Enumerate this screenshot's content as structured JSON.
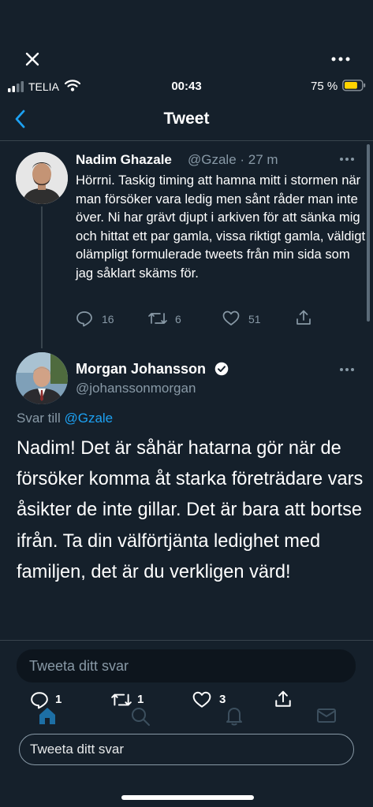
{
  "status_bar": {
    "carrier": "TELIA",
    "time": "00:43",
    "battery_percent": "75 %",
    "battery_level": 0.75,
    "colors": {
      "battery": "#ffd400"
    }
  },
  "nav": {
    "title": "Tweet",
    "back_icon": "chevron-left-icon"
  },
  "tweet1": {
    "name": "Nadim Ghazale",
    "handle_time": "@Gzale · 27 m",
    "text": "Hörrni. Taskig timing att hamna mitt i stormen när man försöker vara ledig men sånt råder man inte över. Ni har grävt djupt i arkiven för att sänka mig och hittat ett par gamla, vissa riktigt gamla, väldigt olämpligt formulerade tweets från min sida som jag såklart skäms för.",
    "replies": "16",
    "retweets": "6",
    "likes": "51"
  },
  "tweet2": {
    "name": "Morgan Johansson",
    "handle": "@johanssonmorgan",
    "reply_prefix": "Svar till ",
    "reply_handle": "@Gzale",
    "text": "Nadim! Det är såhär hatarna gör när de försöker komma åt starka företrädare vars åsikter de inte gillar. Det är bara att bortse ifrån. Ta din välförtjänta ledighet med familjen, det är du verkligen värd!"
  },
  "reply_box": {
    "placeholder": "Tweeta ditt svar"
  },
  "bottom_actions": {
    "replies": "1",
    "retweets": "1",
    "likes": "3"
  },
  "reply_box_2": {
    "label": "Tweeta ditt svar"
  },
  "colors": {
    "background": "#15202b",
    "accent": "#1da1f2",
    "muted": "#8899a6",
    "divider": "#38444d"
  }
}
